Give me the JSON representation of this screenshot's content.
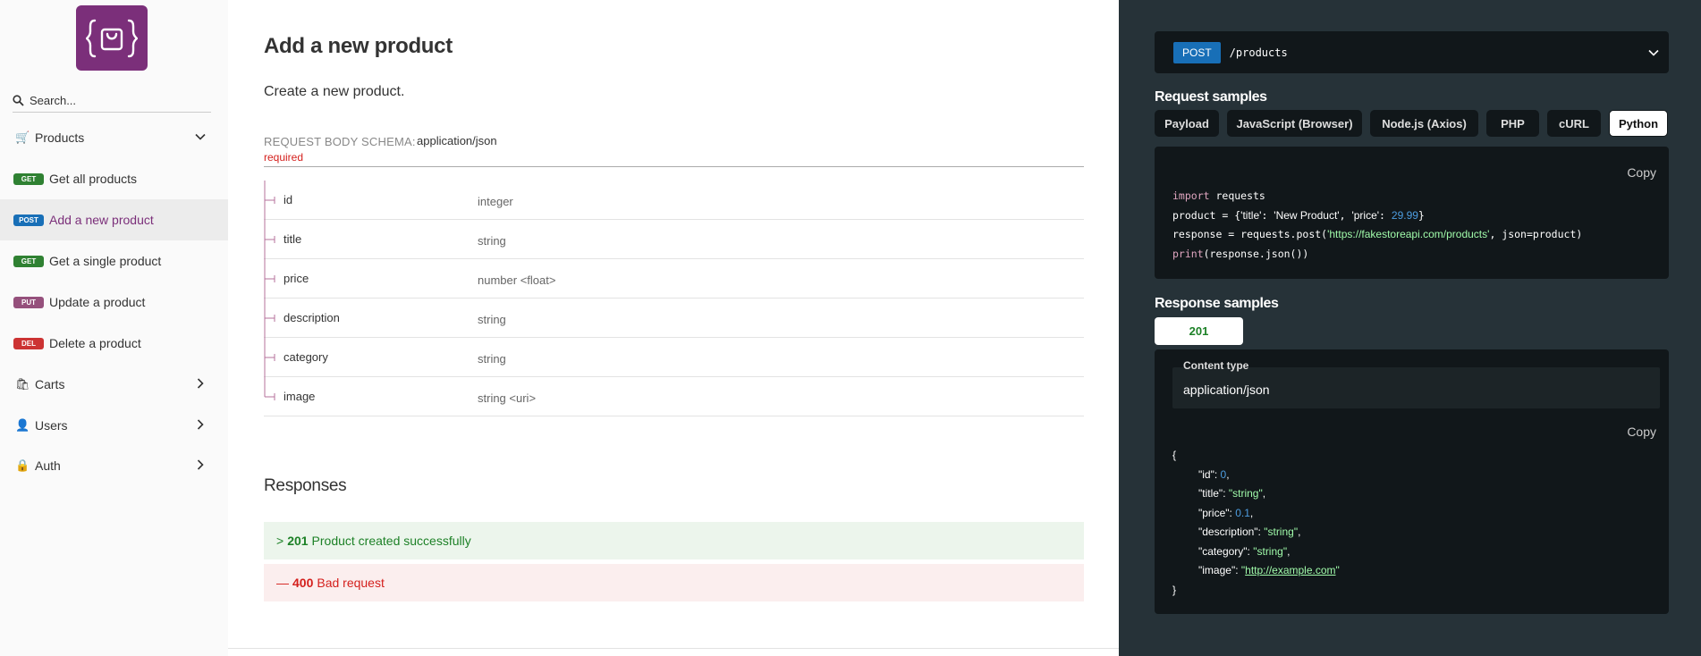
{
  "colors": {
    "brand": "#7b2f7a",
    "get": "#2f8132",
    "post": "#186fb7",
    "put": "#95507c",
    "delete": "#cc3333",
    "panel": "#263238",
    "success": "#1d8127",
    "error": "#d41f1c"
  },
  "sidebar": {
    "search_placeholder": "Search...",
    "groups": [
      {
        "label": "Products",
        "icon": "cart-icon",
        "expanded": true
      },
      {
        "label": "Carts",
        "icon": "shopping-bags-icon",
        "expanded": false
      },
      {
        "label": "Users",
        "icon": "user-icon",
        "expanded": false
      },
      {
        "label": "Auth",
        "icon": "lock-icon",
        "expanded": false
      }
    ],
    "items": [
      {
        "method": "GET",
        "label": "Get all products"
      },
      {
        "method": "POST",
        "label": "Add a new product"
      },
      {
        "method": "GET",
        "label": "Get a single product"
      },
      {
        "method": "PUT",
        "label": "Update a product"
      },
      {
        "method": "DEL",
        "label": "Delete a product"
      }
    ]
  },
  "main": {
    "title": "Add a new product",
    "description": "Create a new product.",
    "schema_label": "REQUEST BODY SCHEMA:",
    "schema_type": "application/json",
    "required_label": "required",
    "properties": [
      {
        "name": "id",
        "type": "integer"
      },
      {
        "name": "title",
        "type": "string"
      },
      {
        "name": "price",
        "type": "number <float>"
      },
      {
        "name": "description",
        "type": "string"
      },
      {
        "name": "category",
        "type": "string"
      },
      {
        "name": "image",
        "type": "string <uri>"
      }
    ],
    "responses_title": "Responses",
    "responses": [
      {
        "toggle": ">",
        "code": "201",
        "text": "Product created successfully"
      },
      {
        "toggle": "—",
        "code": "400",
        "text": "Bad request"
      }
    ]
  },
  "panel": {
    "endpoint_method": "POST",
    "endpoint_path": "/products",
    "request_title": "Request samples",
    "tabs": [
      "Payload",
      "JavaScript (Browser)",
      "Node.js (Axios)",
      "PHP",
      "cURL",
      "Python"
    ],
    "active_tab": "Python",
    "copy_label": "Copy",
    "code": {
      "l1_kw": "import",
      "l1_rest": " requests",
      "l2_var": "product = {",
      "l2_k1": "'title'",
      "l2_sep1": ": ",
      "l2_v1": "'New Product'",
      "l2_comma": ", ",
      "l2_k2": "'price'",
      "l2_sep2": ": ",
      "l2_v2": "29.99",
      "l2_end": "}",
      "l3_start": "response = requests.post(",
      "l3_url": "'https://fakestoreapi.com/products'",
      "l3_end": ", json=product)",
      "l4_fn": "print",
      "l4_rest": "(response.json())"
    },
    "response_title": "Response samples",
    "status_tab": "201",
    "content_type_label": "Content type",
    "content_type_value": "application/json",
    "json": {
      "open": "{",
      "close": "}",
      "id_key": "\"id\": ",
      "id_val": "0",
      "title_key": "\"title\": ",
      "title_val": "\"string\"",
      "price_key": "\"price\": ",
      "price_val": "0.1",
      "desc_key": "\"description\": ",
      "desc_val": "\"string\"",
      "cat_key": "\"category\": ",
      "cat_val": "\"string\"",
      "image_key": "\"image\": ",
      "image_quote": "\"",
      "image_val": "http://example.com"
    }
  }
}
